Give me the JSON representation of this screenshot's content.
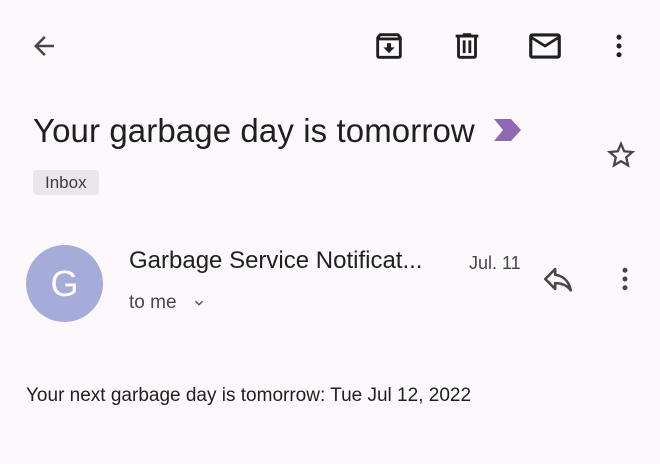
{
  "toolbar": {
    "back_icon": "arrow-back-icon",
    "archive_icon": "archive-icon",
    "delete_icon": "trash-icon",
    "mark_unread_icon": "mail-icon",
    "more_icon": "more-vert-icon"
  },
  "email": {
    "subject": "Your garbage day is tomorrow",
    "importance_marker_color": "#8e6ab4",
    "label": "Inbox",
    "star_icon": "star-outline-icon"
  },
  "message": {
    "avatar_letter": "G",
    "avatar_color": "#a6acd9",
    "sender": "Garbage Service Notificat...",
    "date": "Jul. 11",
    "recipient": "to me",
    "recipient_chevron_icon": "chevron-down-icon",
    "reply_icon": "reply-icon",
    "more_icon": "more-vert-icon",
    "body": "Your next garbage day is tomorrow: Tue Jul 12, 2022"
  }
}
